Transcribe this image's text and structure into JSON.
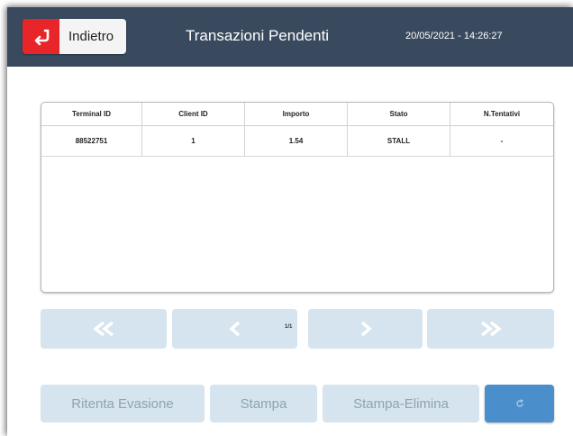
{
  "header": {
    "back_label": "Indietro",
    "title": "Transazioni Pendenti",
    "datetime": "20/05/2021 - 14:26:27"
  },
  "table": {
    "columns": [
      "Terminal ID",
      "Client ID",
      "Importo",
      "Stato",
      "N.Tentativi"
    ],
    "rows": [
      [
        "88522751",
        "1",
        "1.54",
        "STALL",
        "-"
      ]
    ]
  },
  "pager": {
    "indicator": "1/1"
  },
  "actions": {
    "retry_label": "Ritenta Evasione",
    "print_label": "Stampa",
    "print_delete_label": "Stampa-Elimina"
  },
  "icons": {
    "back": "return-arrow-icon",
    "first": "double-chevron-left-icon",
    "prev": "chevron-left-icon",
    "next": "chevron-right-icon",
    "last": "double-chevron-right-icon",
    "refresh": "refresh-icon"
  },
  "colors": {
    "header_bg": "#3a4a5e",
    "back_accent": "#e8262a",
    "button_disabled": "#d5e4ee",
    "refresh_blue": "#4a8fcb"
  }
}
